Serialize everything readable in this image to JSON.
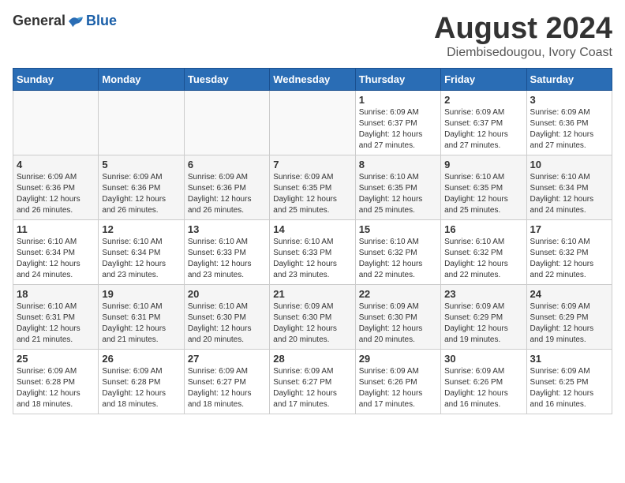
{
  "logo": {
    "general": "General",
    "blue": "Blue"
  },
  "title": "August 2024",
  "subtitle": "Diembisedougou, Ivory Coast",
  "days_of_week": [
    "Sunday",
    "Monday",
    "Tuesday",
    "Wednesday",
    "Thursday",
    "Friday",
    "Saturday"
  ],
  "weeks": [
    [
      {
        "day": "",
        "info": ""
      },
      {
        "day": "",
        "info": ""
      },
      {
        "day": "",
        "info": ""
      },
      {
        "day": "",
        "info": ""
      },
      {
        "day": "1",
        "info": "Sunrise: 6:09 AM\nSunset: 6:37 PM\nDaylight: 12 hours\nand 27 minutes."
      },
      {
        "day": "2",
        "info": "Sunrise: 6:09 AM\nSunset: 6:37 PM\nDaylight: 12 hours\nand 27 minutes."
      },
      {
        "day": "3",
        "info": "Sunrise: 6:09 AM\nSunset: 6:36 PM\nDaylight: 12 hours\nand 27 minutes."
      }
    ],
    [
      {
        "day": "4",
        "info": "Sunrise: 6:09 AM\nSunset: 6:36 PM\nDaylight: 12 hours\nand 26 minutes."
      },
      {
        "day": "5",
        "info": "Sunrise: 6:09 AM\nSunset: 6:36 PM\nDaylight: 12 hours\nand 26 minutes."
      },
      {
        "day": "6",
        "info": "Sunrise: 6:09 AM\nSunset: 6:36 PM\nDaylight: 12 hours\nand 26 minutes."
      },
      {
        "day": "7",
        "info": "Sunrise: 6:09 AM\nSunset: 6:35 PM\nDaylight: 12 hours\nand 25 minutes."
      },
      {
        "day": "8",
        "info": "Sunrise: 6:10 AM\nSunset: 6:35 PM\nDaylight: 12 hours\nand 25 minutes."
      },
      {
        "day": "9",
        "info": "Sunrise: 6:10 AM\nSunset: 6:35 PM\nDaylight: 12 hours\nand 25 minutes."
      },
      {
        "day": "10",
        "info": "Sunrise: 6:10 AM\nSunset: 6:34 PM\nDaylight: 12 hours\nand 24 minutes."
      }
    ],
    [
      {
        "day": "11",
        "info": "Sunrise: 6:10 AM\nSunset: 6:34 PM\nDaylight: 12 hours\nand 24 minutes."
      },
      {
        "day": "12",
        "info": "Sunrise: 6:10 AM\nSunset: 6:34 PM\nDaylight: 12 hours\nand 23 minutes."
      },
      {
        "day": "13",
        "info": "Sunrise: 6:10 AM\nSunset: 6:33 PM\nDaylight: 12 hours\nand 23 minutes."
      },
      {
        "day": "14",
        "info": "Sunrise: 6:10 AM\nSunset: 6:33 PM\nDaylight: 12 hours\nand 23 minutes."
      },
      {
        "day": "15",
        "info": "Sunrise: 6:10 AM\nSunset: 6:32 PM\nDaylight: 12 hours\nand 22 minutes."
      },
      {
        "day": "16",
        "info": "Sunrise: 6:10 AM\nSunset: 6:32 PM\nDaylight: 12 hours\nand 22 minutes."
      },
      {
        "day": "17",
        "info": "Sunrise: 6:10 AM\nSunset: 6:32 PM\nDaylight: 12 hours\nand 22 minutes."
      }
    ],
    [
      {
        "day": "18",
        "info": "Sunrise: 6:10 AM\nSunset: 6:31 PM\nDaylight: 12 hours\nand 21 minutes."
      },
      {
        "day": "19",
        "info": "Sunrise: 6:10 AM\nSunset: 6:31 PM\nDaylight: 12 hours\nand 21 minutes."
      },
      {
        "day": "20",
        "info": "Sunrise: 6:10 AM\nSunset: 6:30 PM\nDaylight: 12 hours\nand 20 minutes."
      },
      {
        "day": "21",
        "info": "Sunrise: 6:09 AM\nSunset: 6:30 PM\nDaylight: 12 hours\nand 20 minutes."
      },
      {
        "day": "22",
        "info": "Sunrise: 6:09 AM\nSunset: 6:30 PM\nDaylight: 12 hours\nand 20 minutes."
      },
      {
        "day": "23",
        "info": "Sunrise: 6:09 AM\nSunset: 6:29 PM\nDaylight: 12 hours\nand 19 minutes."
      },
      {
        "day": "24",
        "info": "Sunrise: 6:09 AM\nSunset: 6:29 PM\nDaylight: 12 hours\nand 19 minutes."
      }
    ],
    [
      {
        "day": "25",
        "info": "Sunrise: 6:09 AM\nSunset: 6:28 PM\nDaylight: 12 hours\nand 18 minutes."
      },
      {
        "day": "26",
        "info": "Sunrise: 6:09 AM\nSunset: 6:28 PM\nDaylight: 12 hours\nand 18 minutes."
      },
      {
        "day": "27",
        "info": "Sunrise: 6:09 AM\nSunset: 6:27 PM\nDaylight: 12 hours\nand 18 minutes."
      },
      {
        "day": "28",
        "info": "Sunrise: 6:09 AM\nSunset: 6:27 PM\nDaylight: 12 hours\nand 17 minutes."
      },
      {
        "day": "29",
        "info": "Sunrise: 6:09 AM\nSunset: 6:26 PM\nDaylight: 12 hours\nand 17 minutes."
      },
      {
        "day": "30",
        "info": "Sunrise: 6:09 AM\nSunset: 6:26 PM\nDaylight: 12 hours\nand 16 minutes."
      },
      {
        "day": "31",
        "info": "Sunrise: 6:09 AM\nSunset: 6:25 PM\nDaylight: 12 hours\nand 16 minutes."
      }
    ]
  ]
}
